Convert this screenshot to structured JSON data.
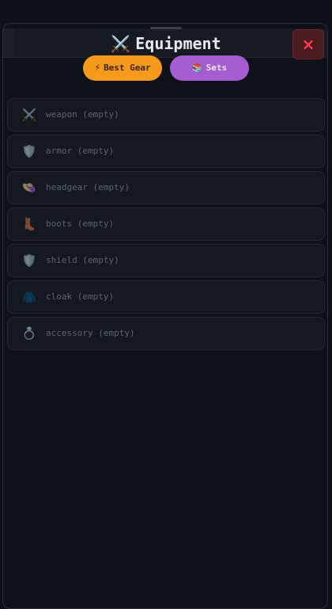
{
  "header": {
    "title_icon": "⚔️",
    "title": "Equipment",
    "close_label": "×"
  },
  "actions": {
    "best_gear": {
      "icon": "⚡",
      "label": "Best Gear"
    },
    "sets": {
      "icon": "📚",
      "label": "Sets"
    }
  },
  "slots": [
    {
      "icon_name": "crossed-swords-icon",
      "icon": "⚔️",
      "label": "weapon (empty)"
    },
    {
      "icon_name": "shield-icon",
      "icon": "🛡️",
      "label": "armor (empty)"
    },
    {
      "icon_name": "hat-icon",
      "icon": "👒",
      "label": "headgear (empty)"
    },
    {
      "icon_name": "boot-icon",
      "icon": "👢",
      "label": "boots (empty)"
    },
    {
      "icon_name": "shield-icon",
      "icon": "🛡️",
      "label": "shield (empty)"
    },
    {
      "icon_name": "coat-icon",
      "icon": "🧥",
      "label": "cloak (empty)"
    },
    {
      "icon_name": "ring-icon",
      "icon": "💍",
      "label": "accessory (empty)"
    }
  ],
  "colors": {
    "best_gear_bg": "#f59a1b",
    "sets_bg": "#a55ed1",
    "close_accent": "#ff3b55",
    "background": "#0d1117"
  }
}
